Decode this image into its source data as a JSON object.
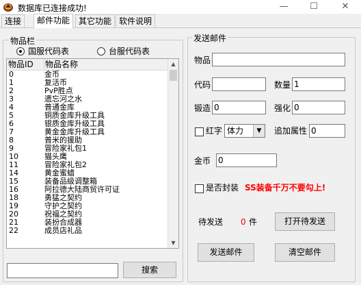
{
  "window": {
    "title": "数据库已连接成功!",
    "minimize": "—",
    "maximize": "☐",
    "close": "✕"
  },
  "tabs": [
    {
      "label": "连接"
    },
    {
      "label": "邮件功能"
    },
    {
      "label": "其它功能"
    },
    {
      "label": "软件说明"
    }
  ],
  "items_panel": {
    "title": "物品栏",
    "radio_domestic": "国服代码表",
    "radio_taiwan": "台服代码表",
    "columns": [
      "物品ID",
      "物品名称"
    ],
    "rows": [
      {
        "id": "0",
        "name": "金币"
      },
      {
        "id": "1",
        "name": "复活币"
      },
      {
        "id": "2",
        "name": "PvP胜点"
      },
      {
        "id": "3",
        "name": "遗忘河之水"
      },
      {
        "id": "4",
        "name": "普通金库"
      },
      {
        "id": "5",
        "name": "铜质金库升级工具"
      },
      {
        "id": "6",
        "name": "银质金库升级工具"
      },
      {
        "id": "7",
        "name": "黄金金库升级工具"
      },
      {
        "id": "8",
        "name": "普米的援助"
      },
      {
        "id": "9",
        "name": "冒险家礼包1"
      },
      {
        "id": "10",
        "name": "猫头鹰"
      },
      {
        "id": "11",
        "name": "冒险家礼包2"
      },
      {
        "id": "14",
        "name": "黄金蜜蜡"
      },
      {
        "id": "15",
        "name": "装备品级调整箱"
      },
      {
        "id": "16",
        "name": "阿拉德大陆商贸许可证"
      },
      {
        "id": "18",
        "name": "勇猛之契约"
      },
      {
        "id": "19",
        "name": "守护之契约"
      },
      {
        "id": "20",
        "name": "祝福之契约"
      },
      {
        "id": "21",
        "name": "装扮合成器"
      },
      {
        "id": "22",
        "name": "成员店礼品"
      }
    ],
    "search_value": "",
    "search_button": "搜索"
  },
  "mail_panel": {
    "title": "发送邮件",
    "item_label": "物品",
    "item_value": "",
    "code_label": "代码",
    "code_value": "",
    "qty_label": "数量",
    "qty_value": "1",
    "forge_label": "锻造",
    "forge_value": "0",
    "enhance_label": "强化",
    "enhance_value": "0",
    "redword_label": "红字",
    "redword_select": "体力",
    "extra_attr_label": "追加属性",
    "extra_attr_value": "0",
    "gold_label": "金币",
    "gold_value": "0",
    "seal_label": "是否封装",
    "seal_warning": "SS装备千万不要勾上!",
    "pending_label": "待发送",
    "pending_count": "0",
    "pending_unit": "件",
    "open_pending_button": "打开待发送",
    "send_button": "发送邮件",
    "clear_button": "清空邮件"
  },
  "colors": {
    "warning": "#ff0000",
    "count": "#ff0000",
    "accent": "#0078d7"
  }
}
